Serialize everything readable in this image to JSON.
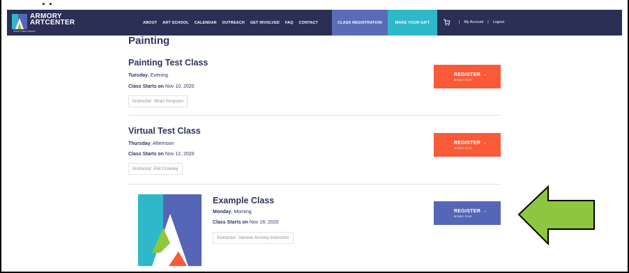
{
  "header": {
    "logo_line1": "ARMORY",
    "logo_line2": "ARTCENTER",
    "logo_sub": "West Palm Beach",
    "nav_items": [
      "ABOUT",
      "ART SCHOOL",
      "CALENDAR",
      "OUTREACH",
      "GET INVOLVED",
      "FAQ",
      "CONTACT"
    ],
    "class_registration": "CLASS REGISTRATION",
    "make_your_gift": "MAKE YOUR GIFT",
    "my_account": "My Account",
    "separator": "|",
    "logout": "Logout"
  },
  "section": {
    "title": "Painting"
  },
  "classes": [
    {
      "title": "Painting Test Class",
      "day": "Tuesday",
      "time": ", Evening",
      "starts_label": "Class Starts on",
      "starts_date": " Nov 10, 2020",
      "instructor": "Instructor: Shari Simpson",
      "button": "REGISTER →",
      "button_sub": "& learn more"
    },
    {
      "title": "Virtual Test Class",
      "day": "Thursday",
      "time": ", Afternoon",
      "starts_label": "Class Starts on",
      "starts_date": " Nov 12, 2020",
      "instructor": "Instructor: Pat Crowley",
      "button": "REGISTER →",
      "button_sub": "& learn more"
    },
    {
      "title": "Example Class",
      "day": "Monday",
      "time": ", Morning",
      "starts_label": "Class Starts on",
      "starts_date": " Nov 16, 2020",
      "instructor": "Instructor: Various Armory Instructor",
      "button": "REGISTER →",
      "button_sub": "& learn more"
    }
  ],
  "colors": {
    "nav_bg": "#2b2f55",
    "registration_tab": "#5a6bb8",
    "gift_tab": "#2eb8c9",
    "register_orange": "#fa5a37",
    "register_blue": "#5566b6",
    "text": "#2e3560",
    "arrow": "#8dc63f"
  },
  "icons": [
    "armory-logo-icon",
    "cart-icon",
    "class-thumbnail-logo",
    "green-arrow-icon"
  ]
}
